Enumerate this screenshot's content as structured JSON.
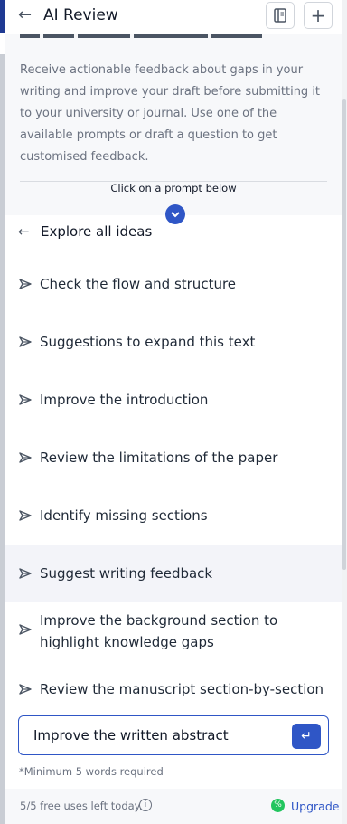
{
  "header": {
    "title": "AI Review"
  },
  "intro": {
    "description": "Receive actionable feedback about gaps in your writing and improve your draft before submitting it to your university or journal. Use one of the available prompts or draft a question to get customised feedback.",
    "click_prompt": "Click on a prompt below"
  },
  "explore": {
    "label": "Explore all ideas"
  },
  "prompts": [
    {
      "label": "Check the flow and structure"
    },
    {
      "label": "Suggestions to expand this text"
    },
    {
      "label": "Improve the introduction"
    },
    {
      "label": "Review the limitations of the paper"
    },
    {
      "label": "Identify missing sections"
    },
    {
      "label": "Suggest writing feedback"
    },
    {
      "label": "Improve the background section to highlight knowledge gaps"
    },
    {
      "label": "Review the manuscript section-by-section"
    }
  ],
  "input": {
    "value": "Improve the written abstract",
    "note": "*Minimum 5 words required"
  },
  "footer": {
    "uses_text": "5/5 free uses left today.",
    "upgrade_label": "Upgrade"
  },
  "colors": {
    "accent": "#2f56c6",
    "upgrade_icon": "#22c55e"
  }
}
